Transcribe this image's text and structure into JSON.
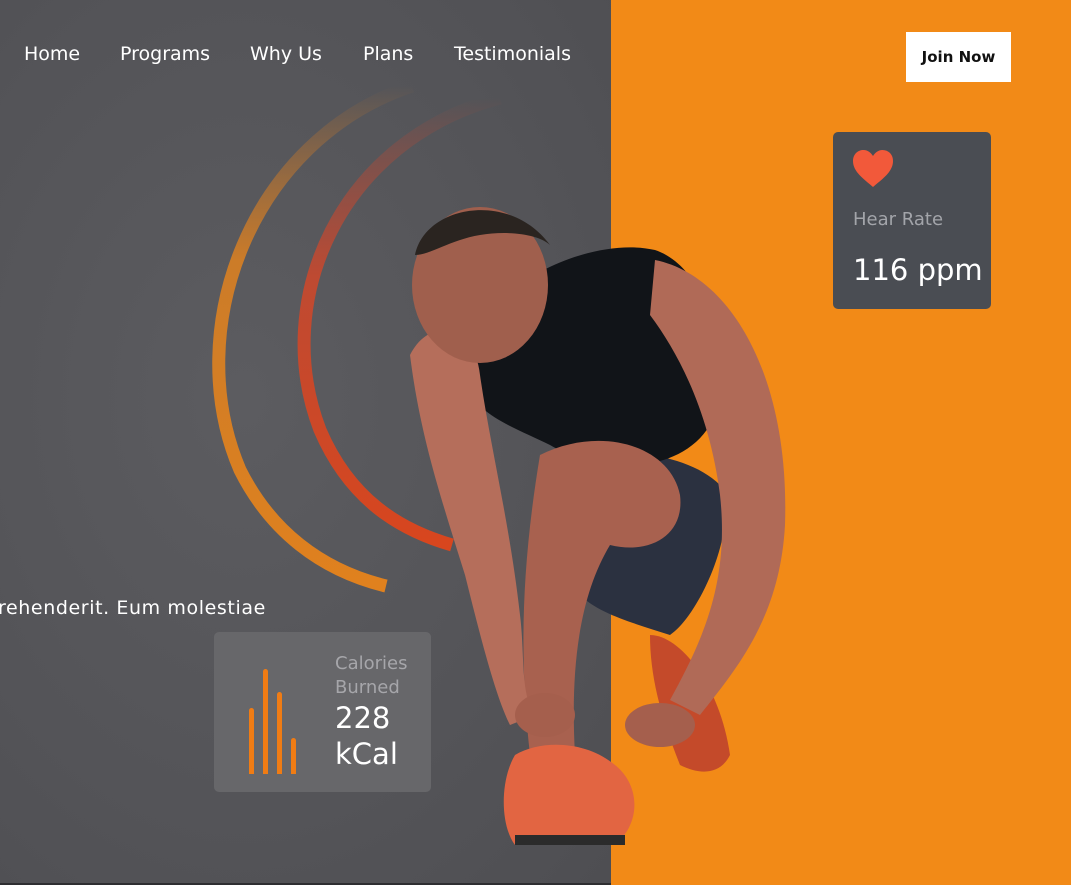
{
  "nav": {
    "items": [
      {
        "label": "Home"
      },
      {
        "label": "Programs"
      },
      {
        "label": "Why Us"
      },
      {
        "label": "Plans"
      },
      {
        "label": "Testimonials"
      }
    ]
  },
  "header": {
    "cta_label": "Join Now"
  },
  "hero": {
    "text_fragment": "rehenderit. Eum molestiae"
  },
  "heart_card": {
    "label": "Hear Rate",
    "value": "116 ppm",
    "icon": "heart-icon"
  },
  "calories_card": {
    "label": "Calories Burned",
    "value": "228 kCal",
    "icon": "bars-icon"
  },
  "colors": {
    "left_bg": "#56565a",
    "accent": "#f28a17",
    "card_dark": "#4a4d53",
    "card_gray": "#67676a",
    "heart": "#f2593a"
  }
}
